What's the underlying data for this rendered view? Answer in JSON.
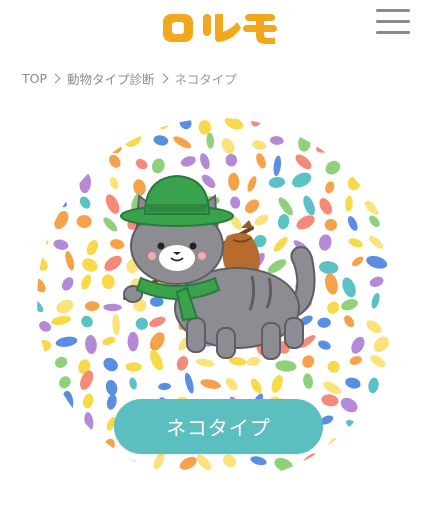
{
  "header": {
    "logo_text": "ロルモ",
    "logo_color": "#f2a81d",
    "menu_icon": "hamburger-menu-icon"
  },
  "breadcrumb": {
    "items": [
      {
        "label": "TOP"
      },
      {
        "label": "動物タイプ診断"
      },
      {
        "label": "ネコタイプ"
      }
    ]
  },
  "hero": {
    "illustration": "gray cat traveler with green hat, green scarf and bundle on stick",
    "result_button_label": "ネコタイプ",
    "button_color": "#5bbfbf"
  }
}
